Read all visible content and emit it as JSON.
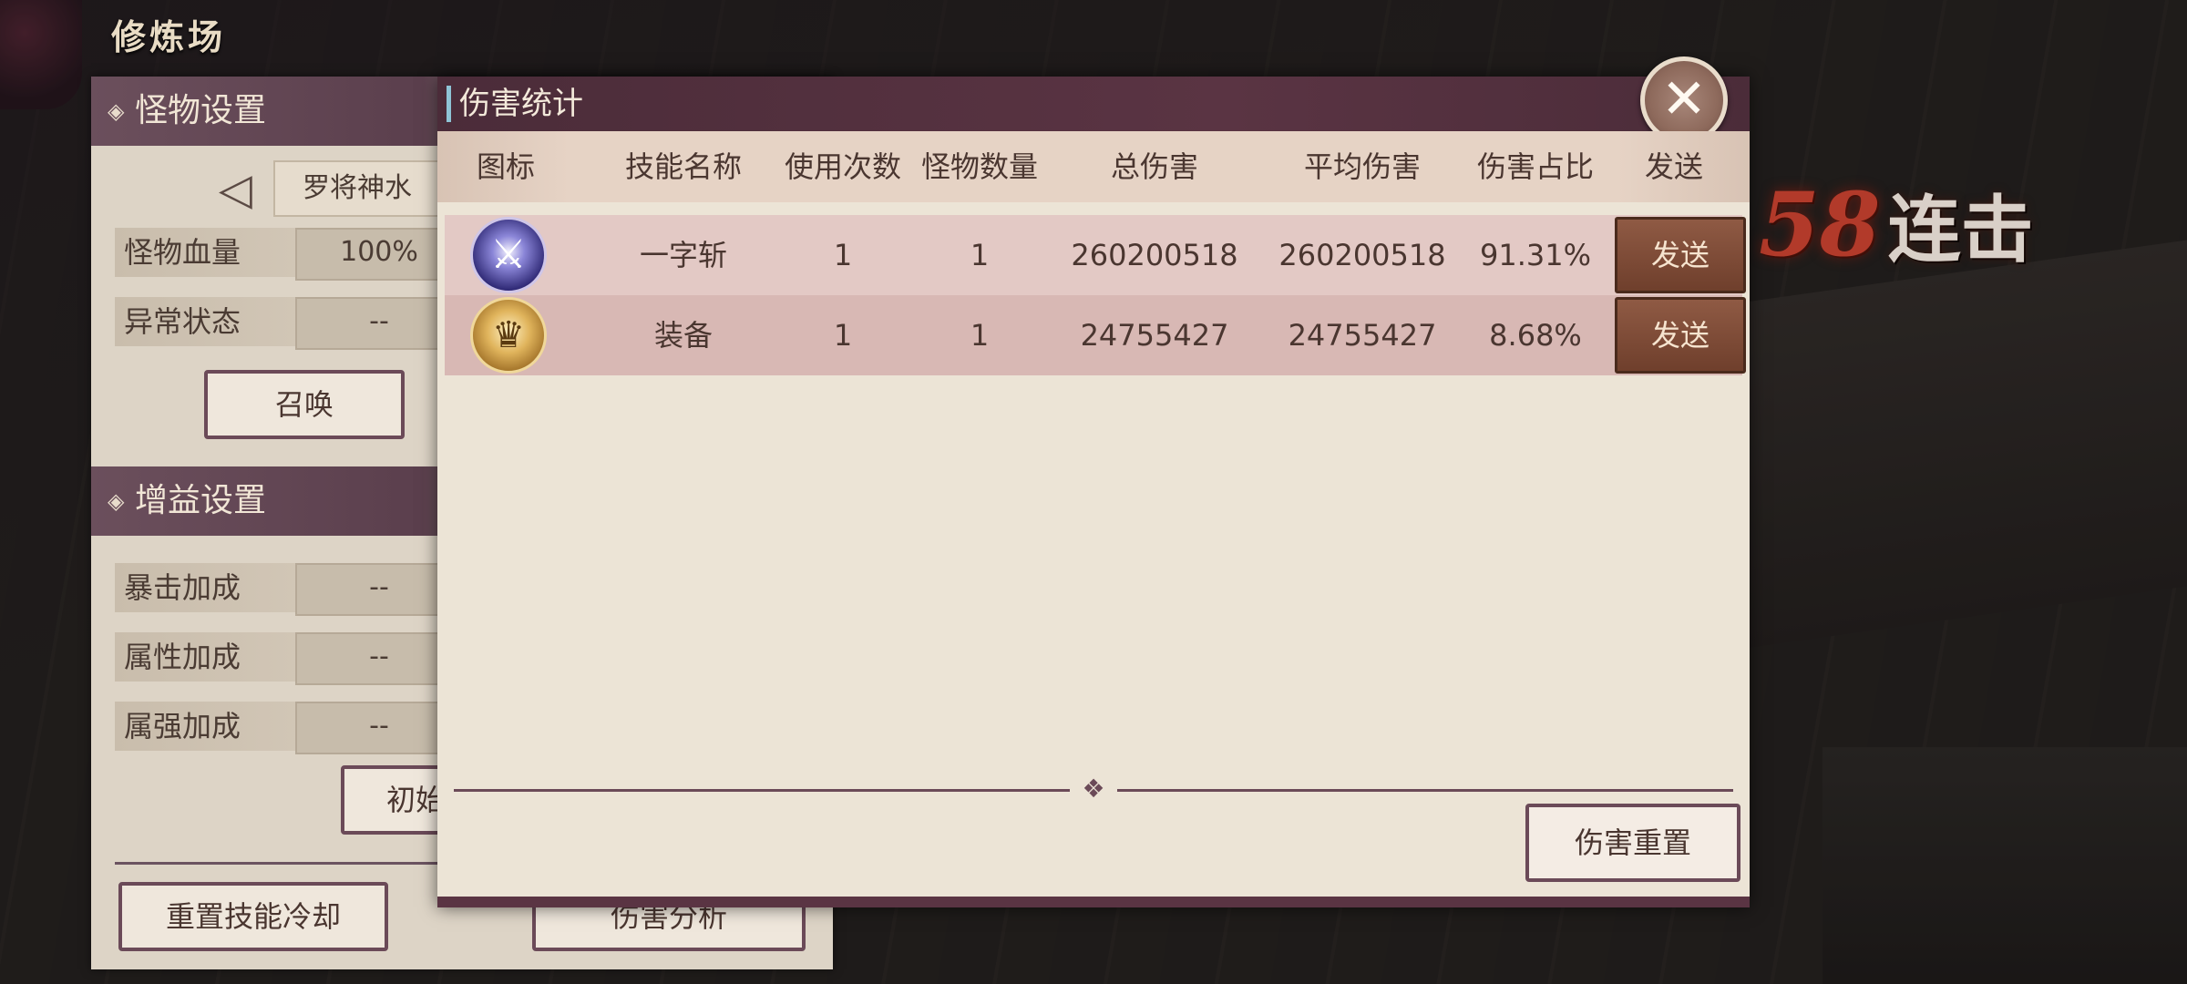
{
  "scene": {
    "title": "修炼场"
  },
  "combo": {
    "count": "58",
    "text": "连击"
  },
  "monster_settings": {
    "header": "怪物设置",
    "selected_monster": "罗将神水",
    "hp_label": "怪物血量",
    "hp_value": "100%",
    "status_label": "异常状态",
    "status_value": "--",
    "summon_button": "召唤"
  },
  "buff_settings": {
    "header": "增益设置",
    "crit_label": "暴击加成",
    "crit_value": "--",
    "attr_label": "属性加成",
    "attr_value": "--",
    "elem_label": "属强加成",
    "elem_value": "--",
    "init_button": "初始"
  },
  "bottom_buttons": {
    "reset_cooldown": "重置技能冷却",
    "damage_analysis": "伤害分析"
  },
  "dialog": {
    "title": "伤害统计",
    "headers": [
      "图标",
      "技能名称",
      "使用次数",
      "怪物数量",
      "总伤害",
      "平均伤害",
      "伤害占比",
      "发送"
    ],
    "rows": [
      {
        "icon": "sword-slash-skill-icon",
        "skill": "一字斩",
        "uses": "1",
        "monsters": "1",
        "total": "260200518",
        "average": "260200518",
        "ratio": "91.31%",
        "send": "发送"
      },
      {
        "icon": "golden-helmet-equipment-icon",
        "skill": "装备",
        "uses": "1",
        "monsters": "1",
        "total": "24755427",
        "average": "24755427",
        "ratio": "8.68%",
        "send": "发送"
      }
    ],
    "reset_button": "伤害重置",
    "ornament": "❖"
  },
  "icons": {
    "close": "✕",
    "left_arrow": "◁",
    "diamond": "◈",
    "skill_glyph": "⚔",
    "equip_glyph": "♛"
  }
}
